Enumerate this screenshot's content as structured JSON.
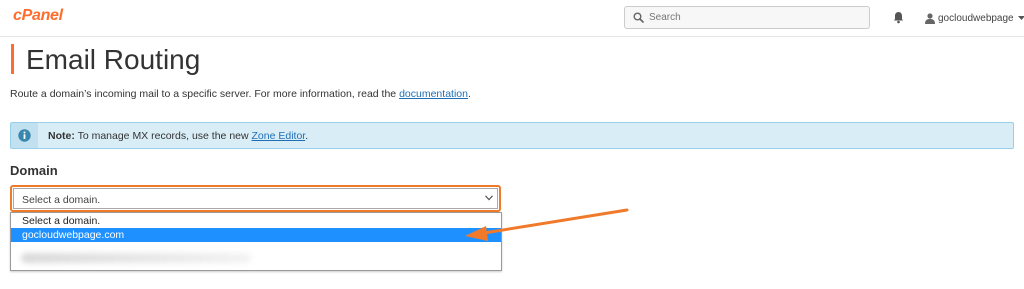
{
  "header": {
    "logo_text": "cPanel",
    "search_placeholder": "Search",
    "username": "gocloudwebpage",
    "icons": [
      "search-icon",
      "bell-icon",
      "user-icon",
      "caret-down-icon"
    ]
  },
  "page": {
    "title": "Email Routing",
    "description_prefix": "Route a domain’s incoming mail to a specific server. For more information, read the ",
    "description_link": "documentation",
    "description_suffix": "."
  },
  "note": {
    "label": "Note:",
    "text_prefix": " To manage MX records, use the new ",
    "link": "Zone Editor",
    "text_suffix": ".",
    "icon": "info-icon"
  },
  "domain": {
    "label": "Domain",
    "selected_value": "Select a domain.",
    "options": [
      "Select a domain.",
      "gocloudwebpage.com"
    ]
  },
  "colors": {
    "accent": "#ff6c2c",
    "annotation": "#f07a2a",
    "link": "#1f6fb5",
    "note_bg": "#d9edf7",
    "note_border": "#9acfea",
    "option_highlight": "#1e90ff"
  }
}
